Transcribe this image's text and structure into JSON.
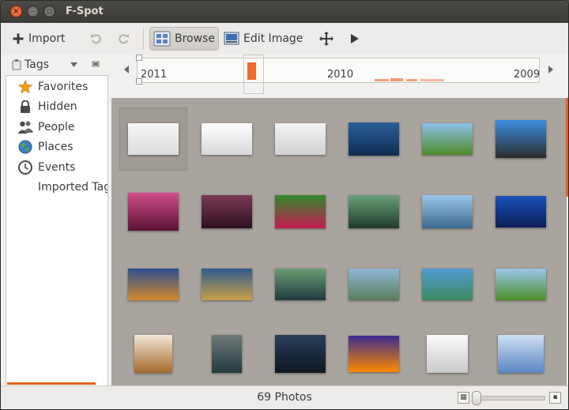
{
  "window": {
    "title": "F-Spot"
  },
  "titlebar": {
    "close_glyph": "×",
    "min_glyph": "–",
    "max_glyph": "▫"
  },
  "toolbar": {
    "import_label": "Import",
    "browse_label": "Browse",
    "edit_image_label": "Edit Image",
    "active_mode": "Browse"
  },
  "tags_selector": {
    "label": "Tags"
  },
  "sidebar": {
    "items": [
      {
        "label": "Favorites",
        "icon": "star-icon"
      },
      {
        "label": "Hidden",
        "icon": "lock-icon"
      },
      {
        "label": "People",
        "icon": "people-icon"
      },
      {
        "label": "Places",
        "icon": "globe-icon"
      },
      {
        "label": "Events",
        "icon": "clock-icon"
      },
      {
        "label": "Imported Tags",
        "icon": ""
      }
    ]
  },
  "timeline": {
    "years": [
      "2011",
      "2010",
      "2009"
    ]
  },
  "status": {
    "photo_count": "69 Photos"
  },
  "colors": {
    "accent": "#e3631c",
    "browser_bg": "#aaa49e"
  },
  "photos": [
    {
      "name": "white-abstract-1",
      "colors": [
        "#f7f7f7",
        "#dcdcdc"
      ]
    },
    {
      "name": "white-abstract-2",
      "colors": [
        "#ffffff",
        "#d8d8d8"
      ]
    },
    {
      "name": "white-abstract-3",
      "colors": [
        "#f3f3f3",
        "#d2d2d2"
      ]
    },
    {
      "name": "blue-sky-mountains",
      "colors": [
        "#2a5f9a",
        "#0e2c52"
      ]
    },
    {
      "name": "green-meadow-tree",
      "colors": [
        "#8ec2e8",
        "#4e8a28"
      ]
    },
    {
      "name": "building-sky",
      "colors": [
        "#3d8fe0",
        "#2c2c2c"
      ]
    },
    {
      "name": "pink-lips",
      "colors": [
        "#d24f8a",
        "#5a1234"
      ]
    },
    {
      "name": "purple-wood",
      "colors": [
        "#7a3a56",
        "#2d1020"
      ]
    },
    {
      "name": "red-tulip",
      "colors": [
        "#2f8a2c",
        "#c41a4f"
      ]
    },
    {
      "name": "forest-waterfall",
      "colors": [
        "#6aa07a",
        "#1e3a2a"
      ]
    },
    {
      "name": "blue-rocks",
      "colors": [
        "#9cc6e8",
        "#3d6a8f"
      ]
    },
    {
      "name": "blue-lake-island",
      "colors": [
        "#1b52b8",
        "#0a1d57"
      ]
    },
    {
      "name": "city-night-reflection",
      "colors": [
        "#2b4f8f",
        "#d38a2a"
      ]
    },
    {
      "name": "lit-village-night",
      "colors": [
        "#2f5a8d",
        "#c8a048"
      ]
    },
    {
      "name": "river-valley",
      "colors": [
        "#6a9e72",
        "#1f3a40"
      ]
    },
    {
      "name": "terraced-fields",
      "colors": [
        "#8fb8d8",
        "#5a7d5a"
      ]
    },
    {
      "name": "rice-terraces",
      "colors": [
        "#4f9bd1",
        "#3e8a62"
      ]
    },
    {
      "name": "green-field-tree",
      "colors": [
        "#9ac5ea",
        "#4f8e2a"
      ]
    },
    {
      "name": "teddy-bear",
      "colors": [
        "#f3e7d6",
        "#a56a2e"
      ]
    },
    {
      "name": "sitting-figure",
      "colors": [
        "#6f7a7a",
        "#233a3d"
      ]
    },
    {
      "name": "dark-blue-cave",
      "colors": [
        "#2a3e5a",
        "#0e1620"
      ]
    },
    {
      "name": "colorful-tux",
      "colors": [
        "#3b2a8f",
        "#ff8a00"
      ]
    },
    {
      "name": "document-screen",
      "colors": [
        "#fbfbfb",
        "#c9c9c9"
      ]
    },
    {
      "name": "desktop-screenshot",
      "colors": [
        "#cfe0f3",
        "#5a86c4"
      ]
    }
  ]
}
